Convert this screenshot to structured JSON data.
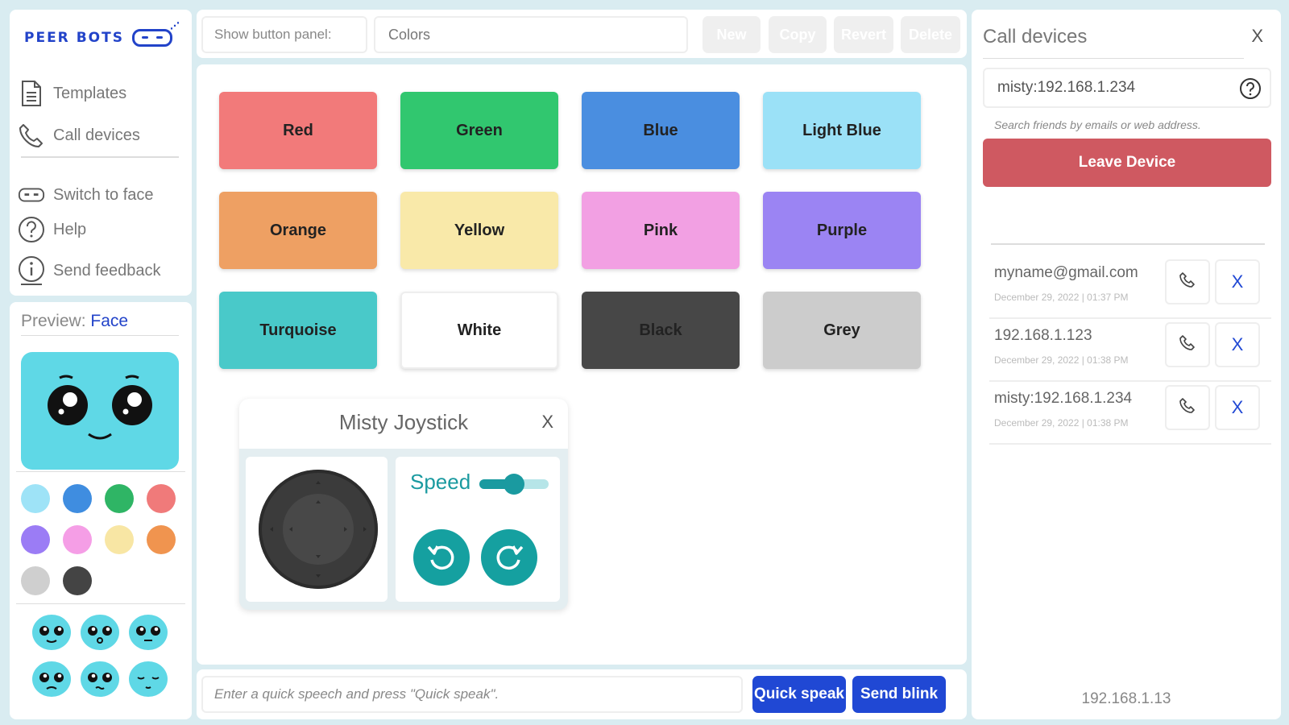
{
  "app": {
    "logo_text": "PEER BOTS"
  },
  "sidebar": {
    "nav": [
      {
        "label": "Templates",
        "icon": "document-icon"
      },
      {
        "label": "Call devices",
        "icon": "phone-icon"
      }
    ],
    "actions": [
      {
        "label": "Switch to face",
        "icon": "robot-face-icon"
      },
      {
        "label": "Help",
        "icon": "question-circle-icon"
      },
      {
        "label": "Send feedback",
        "icon": "info-circle-icon"
      }
    ]
  },
  "preview": {
    "label": "Preview:",
    "value": "Face",
    "face_color": "#5fd8e6",
    "swatches": [
      "#9ee3f7",
      "#3f8de0",
      "#2fb565",
      "#f07a7a",
      "#9b7cf5",
      "#f59ee6",
      "#f8e6a4",
      "#f0944f",
      "#cfcfcf",
      "#444444"
    ],
    "expressions": [
      "happy",
      "surprised",
      "neutral",
      "sad",
      "worried",
      "sleepy"
    ]
  },
  "topbar": {
    "panel_label": "Show button panel:",
    "panel_value": "Colors",
    "buttons": [
      {
        "label": "New",
        "color": "#2048d4"
      },
      {
        "label": "Copy",
        "color": "#2048d4"
      },
      {
        "label": "Revert",
        "color": "#2048d4"
      },
      {
        "label": "Delete",
        "color": "#e02428"
      }
    ]
  },
  "colors": [
    {
      "label": "Red",
      "color": "#f27a7a",
      "text": "#222222"
    },
    {
      "label": "Green",
      "color": "#31c76f",
      "text": "#222222"
    },
    {
      "label": "Blue",
      "color": "#4a8ee0",
      "text": "#222222"
    },
    {
      "label": "Light Blue",
      "color": "#9be1f7",
      "text": "#222222"
    },
    {
      "label": "Orange",
      "color": "#eea063",
      "text": "#222222"
    },
    {
      "label": "Yellow",
      "color": "#f9e9a9",
      "text": "#222222"
    },
    {
      "label": "Pink",
      "color": "#f2a0e3",
      "text": "#222222"
    },
    {
      "label": "Purple",
      "color": "#9b84f3",
      "text": "#222222"
    },
    {
      "label": "Turquoise",
      "color": "#49c9c9",
      "text": "#222222"
    },
    {
      "label": "White",
      "color": "#ffffff",
      "text": "#222222"
    },
    {
      "label": "Black",
      "color": "#474747",
      "text": "#222222"
    },
    {
      "label": "Grey",
      "color": "#cccccc",
      "text": "#222222"
    }
  ],
  "joystick": {
    "title": "Misty Joystick",
    "close": "X",
    "speed_label": "Speed",
    "speed_level": 0.5
  },
  "bottombar": {
    "speech_placeholder": "Enter a quick speech and press \"Quick speak\".",
    "quick_speak": "Quick speak",
    "send_blink": "Send blink"
  },
  "call_devices": {
    "title": "Call devices",
    "close": "X",
    "search_value": "misty:192.168.1.234",
    "search_hint": "Search friends by emails or web address.",
    "leave_button": "Leave Device",
    "devices": [
      {
        "name": "myname@gmail.com",
        "time": "December 29, 2022 | 01:37 PM",
        "remove": "X"
      },
      {
        "name": "192.168.1.123",
        "time": "December 29, 2022 | 01:38 PM",
        "remove": "X"
      },
      {
        "name": "misty:192.168.1.234",
        "time": "December 29, 2022 | 01:38 PM",
        "remove": "X"
      }
    ],
    "local_ip": "192.168.1.13"
  }
}
